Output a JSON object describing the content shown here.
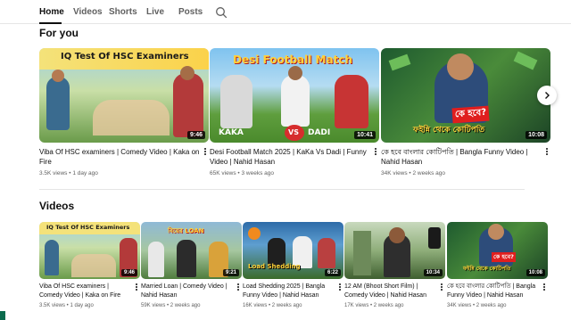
{
  "tabs": [
    {
      "label": "Home",
      "active": true
    },
    {
      "label": "Videos"
    },
    {
      "label": "Shorts"
    },
    {
      "label": "Live"
    },
    {
      "label": "Posts"
    }
  ],
  "for_you": {
    "title": "For you",
    "videos": [
      {
        "title": "Viba Of HSC examiners | Comedy Video | Kaka on Fire",
        "views": "3.5K views",
        "age": "1 day ago",
        "duration": "9:46",
        "thumb_text": "IQ Test Of HSC Examiners"
      },
      {
        "title": "Desi Football Match 2025 | KaKa Vs Dadi | Funny Video | Nahid Hasan",
        "views": "65K views",
        "age": "3 weeks ago",
        "duration": "10:41",
        "thumb_text": "Desi Football Match",
        "thumb_sub_left": "KAKA",
        "thumb_sub_mid": "VS",
        "thumb_sub_right": "DADI"
      },
      {
        "title": "কে হবে বাংলার কোটিপতি | Bangla Funny Video | Nahid Hasan",
        "views": "34K views",
        "age": "2 weeks ago",
        "duration": "10:08",
        "thumb_text": "কে হবে?",
        "thumb_text2": "ফইন্নি থেকে কোটিপতি"
      }
    ]
  },
  "videos": {
    "title": "Videos",
    "items": [
      {
        "title": "Viba Of HSC examiners | Comedy Video | Kaka on Fire",
        "views": "3.5K views",
        "age": "1 day ago",
        "duration": "9:46",
        "thumb_text": "IQ Test Of HSC Examiners"
      },
      {
        "title": "Married Loan | Comedy Video | Nahid Hasan",
        "views": "59K views",
        "age": "2 weeks ago",
        "duration": "9:21",
        "thumb_text": "বিয়ের LOAN"
      },
      {
        "title": "Load Shedding 2025 | Bangla Funny Video | Nahid Hasan",
        "views": "16K views",
        "age": "2 weeks ago",
        "duration": "6:22",
        "thumb_text": "Load Shedding"
      },
      {
        "title": "12 AM (Bhoot Short Film) | Comedy Video | Nahid Hasan",
        "views": "17K views",
        "age": "2 weeks ago",
        "duration": "10:34"
      },
      {
        "title": "কে হবে বাংলার কোটিপতি | Bangla Funny Video | Nahid Hasan",
        "views": "34K views",
        "age": "2 weeks ago",
        "duration": "10:08",
        "thumb_text": "কে হবে?",
        "thumb_text2": "ফইন্নি থেকে কোটিপতি"
      }
    ]
  },
  "icons": {
    "search": "search-icon",
    "next": "chevron-right-icon",
    "more": "more-vert-icon"
  }
}
